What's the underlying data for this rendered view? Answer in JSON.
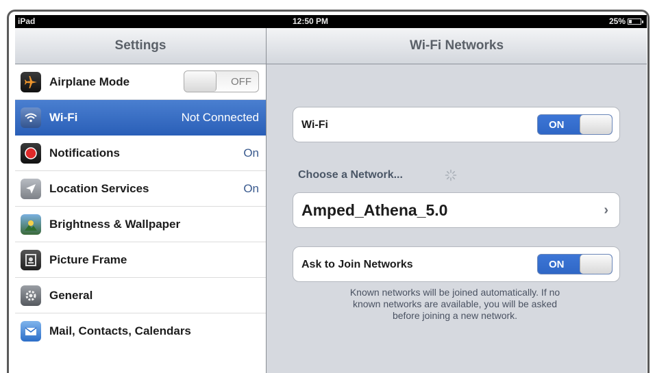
{
  "status_bar": {
    "carrier": "iPad",
    "time": "12:50 PM",
    "battery": "25%",
    "battery_level": 0.25
  },
  "master": {
    "title": "Settings",
    "items": [
      {
        "label": "Airplane Mode",
        "value": "OFF",
        "icon": "airplane-icon",
        "color": "#e8892a"
      },
      {
        "label": "Wi-Fi",
        "value": "Not Connected",
        "icon": "wifi-icon",
        "selected": true
      },
      {
        "label": "Notifications",
        "value": "On",
        "icon": "notifications-icon",
        "color": "#d42a2a"
      },
      {
        "label": "Location Services",
        "value": "On",
        "icon": "location-icon"
      },
      {
        "label": "Brightness & Wallpaper",
        "value": "",
        "icon": "brightness-icon"
      },
      {
        "label": "Picture Frame",
        "value": "",
        "icon": "picture-frame-icon"
      },
      {
        "label": "General",
        "value": "",
        "icon": "gear-icon"
      },
      {
        "label": "Mail, Contacts, Calendars",
        "value": "",
        "icon": "mail-icon"
      }
    ]
  },
  "detail": {
    "title": "Wi-Fi Networks",
    "wifi_label": "Wi-Fi",
    "wifi_toggle": "ON",
    "choose_network": "Choose a Network...",
    "network_name": "Amped_Athena_5.0",
    "ask_join_label": "Ask to Join Networks",
    "ask_join_toggle": "ON",
    "footer_lines": [
      "Known networks will be joined automatically.  If no",
      "known networks are available, you will be asked",
      "before joining a new network."
    ]
  },
  "colors": {
    "selected_row": "#3a6fc6",
    "toggle_on": "#2f67c6",
    "value_text": "#3a5a8e"
  }
}
